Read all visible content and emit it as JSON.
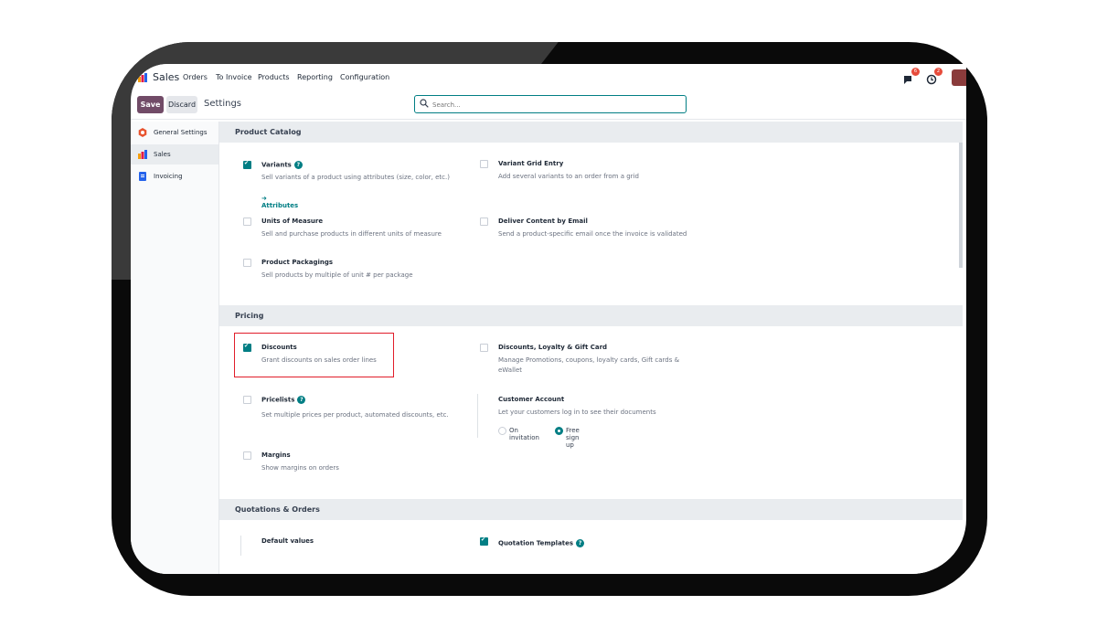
{
  "nav": {
    "app_name": "Sales",
    "menu": [
      "Orders",
      "To Invoice",
      "Products",
      "Reporting",
      "Configuration"
    ],
    "chat_badge": "6",
    "activity_badge": "2"
  },
  "control_panel": {
    "save_label": "Save",
    "discard_label": "Discard",
    "title": "Settings",
    "search_placeholder": "Search..."
  },
  "sidebar": {
    "items": [
      {
        "label": "General Settings",
        "icon": "general-settings-icon"
      },
      {
        "label": "Sales",
        "icon": "sales-icon",
        "active": true
      },
      {
        "label": "Invoicing",
        "icon": "invoicing-icon"
      }
    ]
  },
  "sections": {
    "product_catalog": {
      "title": "Product Catalog",
      "variants": {
        "label": "Variants",
        "desc": "Sell variants of a product using attributes (size, color, etc.)",
        "checked": true,
        "link": "Attributes"
      },
      "variant_grid": {
        "label": "Variant Grid Entry",
        "desc": "Add several variants to an order from a grid",
        "checked": false
      },
      "uom": {
        "label": "Units of Measure",
        "desc": "Sell and purchase products in different units of measure",
        "checked": false
      },
      "deliver_email": {
        "label": "Deliver Content by Email",
        "desc": "Send a product-specific email once the invoice is validated",
        "checked": false
      },
      "packagings": {
        "label": "Product Packagings",
        "desc": "Sell products by multiple of unit # per package",
        "checked": false
      }
    },
    "pricing": {
      "title": "Pricing",
      "discounts": {
        "label": "Discounts",
        "desc": "Grant discounts on sales order lines",
        "checked": true
      },
      "loyalty": {
        "label": "Discounts, Loyalty & Gift Card",
        "desc": "Manage Promotions, coupons, loyalty cards, Gift cards & eWallet",
        "checked": false
      },
      "pricelists": {
        "label": "Pricelists",
        "desc": "Set multiple prices per product, automated discounts, etc.",
        "checked": false
      },
      "customer_account": {
        "label": "Customer Account",
        "desc": "Let your customers log in to see their documents",
        "option_invitation": "On invitation",
        "option_signup": "Free sign up",
        "selected": "Free sign up"
      },
      "margins": {
        "label": "Margins",
        "desc": "Show margins on orders",
        "checked": false
      }
    },
    "quotations": {
      "title": "Quotations & Orders",
      "default_values": {
        "label": "Default values"
      },
      "templates": {
        "label": "Quotation Templates",
        "checked": true
      }
    }
  },
  "colors": {
    "brand": "#714b67",
    "accent": "#017e84",
    "highlight": "#e11d2a"
  }
}
